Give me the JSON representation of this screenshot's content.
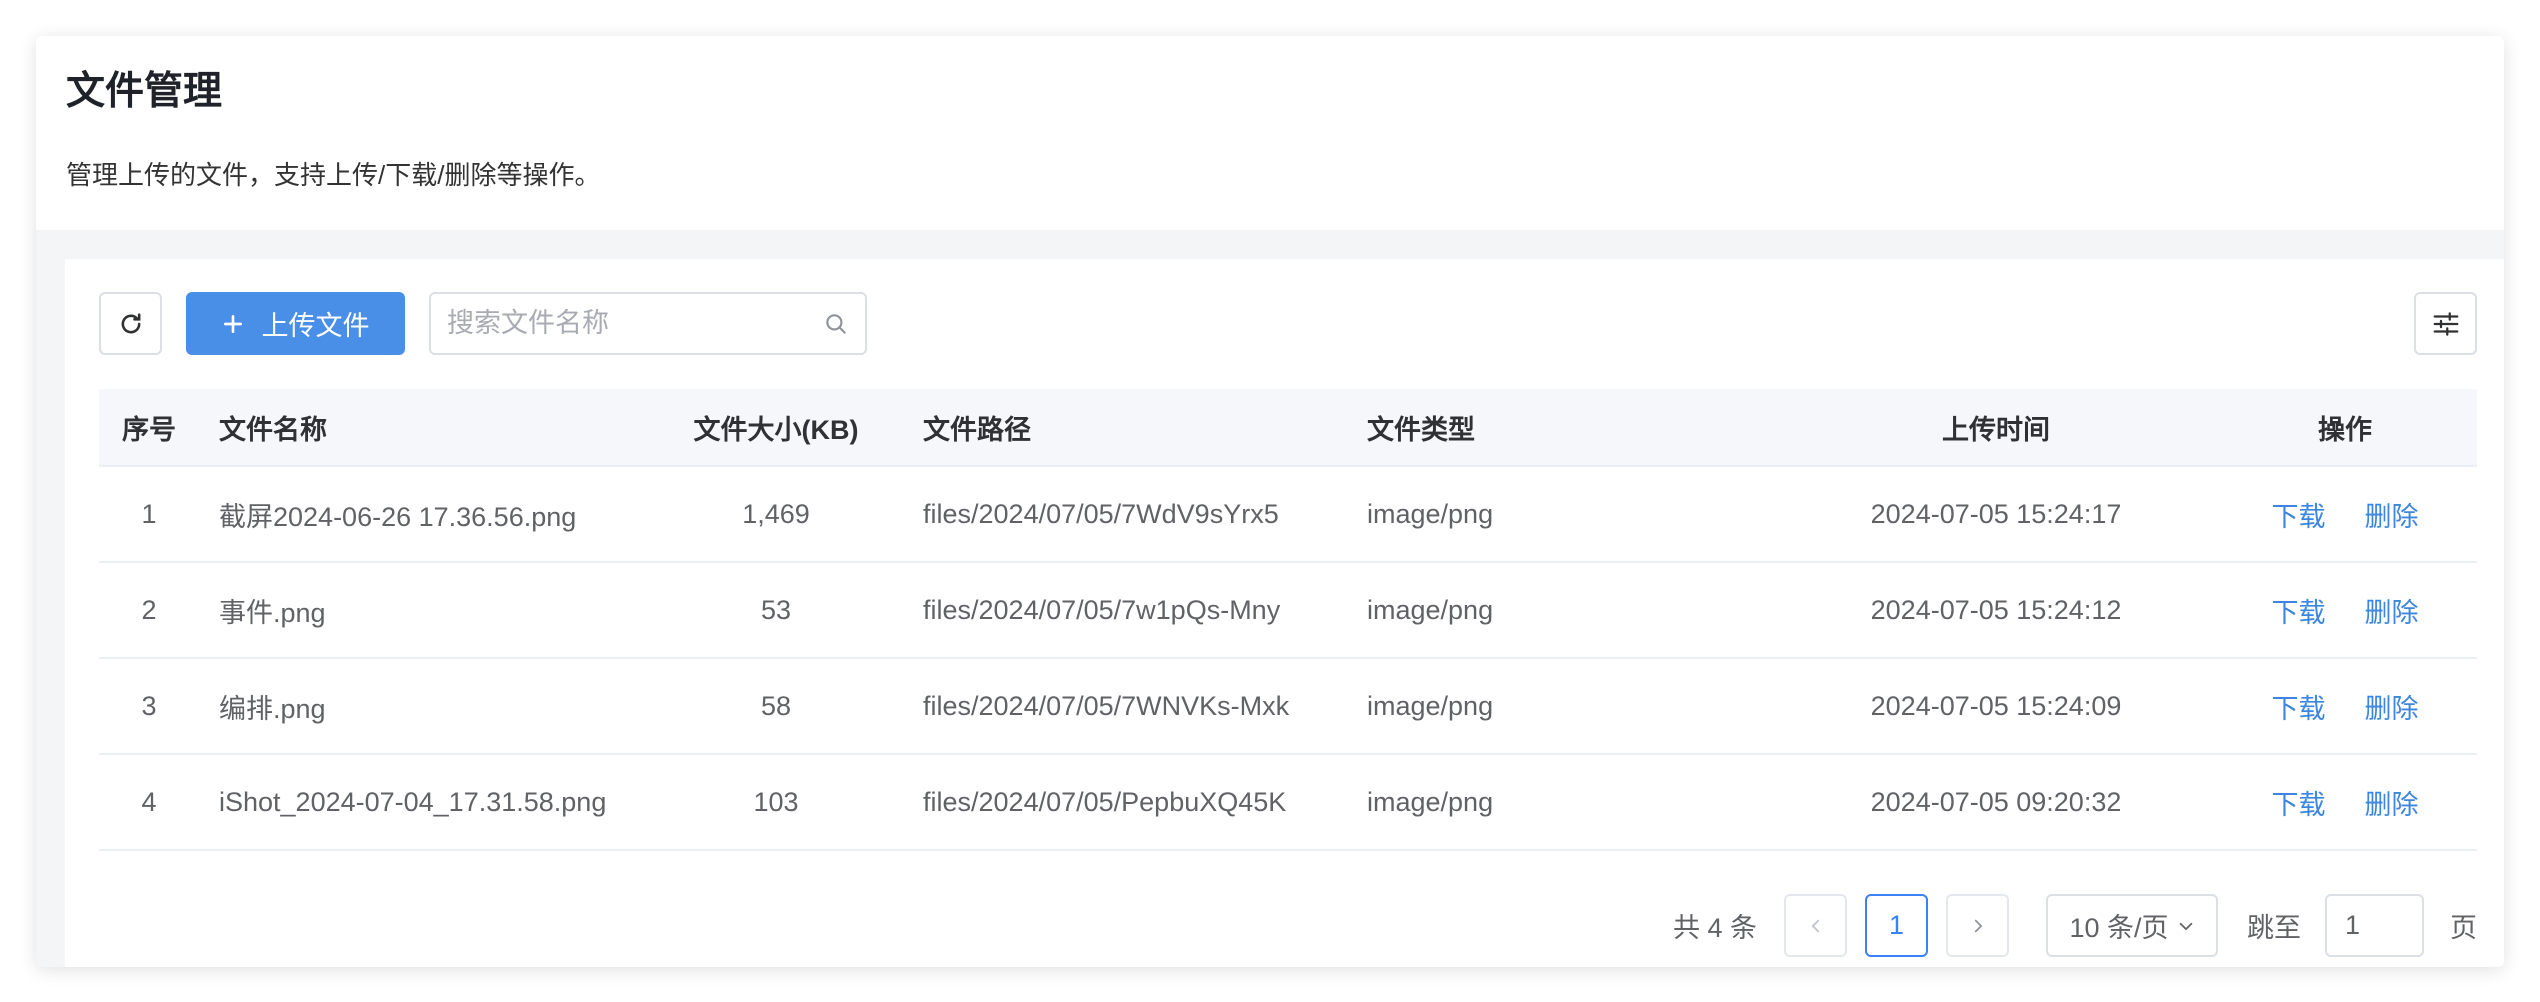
{
  "page": {
    "title": "文件管理",
    "subtitle": "管理上传的文件，支持上传/下载/删除等操作。"
  },
  "toolbar": {
    "refresh_icon": "refresh-icon",
    "upload_icon": "plus-icon",
    "upload_label": "上传文件",
    "search_placeholder": "搜索文件名称",
    "search_icon": "search-icon",
    "settings_icon": "column-settings-icon"
  },
  "table": {
    "columns": [
      {
        "label": "序号"
      },
      {
        "label": "文件名称"
      },
      {
        "label": "文件大小(KB)"
      },
      {
        "label": "文件路径"
      },
      {
        "label": "文件类型"
      },
      {
        "label": "上传时间"
      },
      {
        "label": "操作"
      }
    ],
    "action_labels": {
      "download": "下载",
      "delete": "删除"
    },
    "rows": [
      {
        "index": "1",
        "name": "截屏2024-06-26 17.36.56.png",
        "size": "1,469",
        "path": "files/2024/07/05/7WdV9sYrx5",
        "type": "image/png",
        "time": "2024-07-05 15:24:17"
      },
      {
        "index": "2",
        "name": "事件.png",
        "size": "53",
        "path": "files/2024/07/05/7w1pQs-Mny",
        "type": "image/png",
        "time": "2024-07-05 15:24:12"
      },
      {
        "index": "3",
        "name": "编排.png",
        "size": "58",
        "path": "files/2024/07/05/7WNVKs-Mxk",
        "type": "image/png",
        "time": "2024-07-05 15:24:09"
      },
      {
        "index": "4",
        "name": "iShot_2024-07-04_17.31.58.png",
        "size": "103",
        "path": "files/2024/07/05/PepbuXQ45K",
        "type": "image/png",
        "time": "2024-07-05 09:20:32"
      }
    ]
  },
  "pagination": {
    "total_text": "共 4 条",
    "current_page": "1",
    "page_size": "10 条/页",
    "jump_label": "跳至",
    "jump_value": "1",
    "page_suffix": "页"
  },
  "colors": {
    "primary": "#4a8fe7",
    "link": "#3a86e0",
    "header_bg": "#f5f7fa",
    "page_bg": "#f4f5f7"
  }
}
